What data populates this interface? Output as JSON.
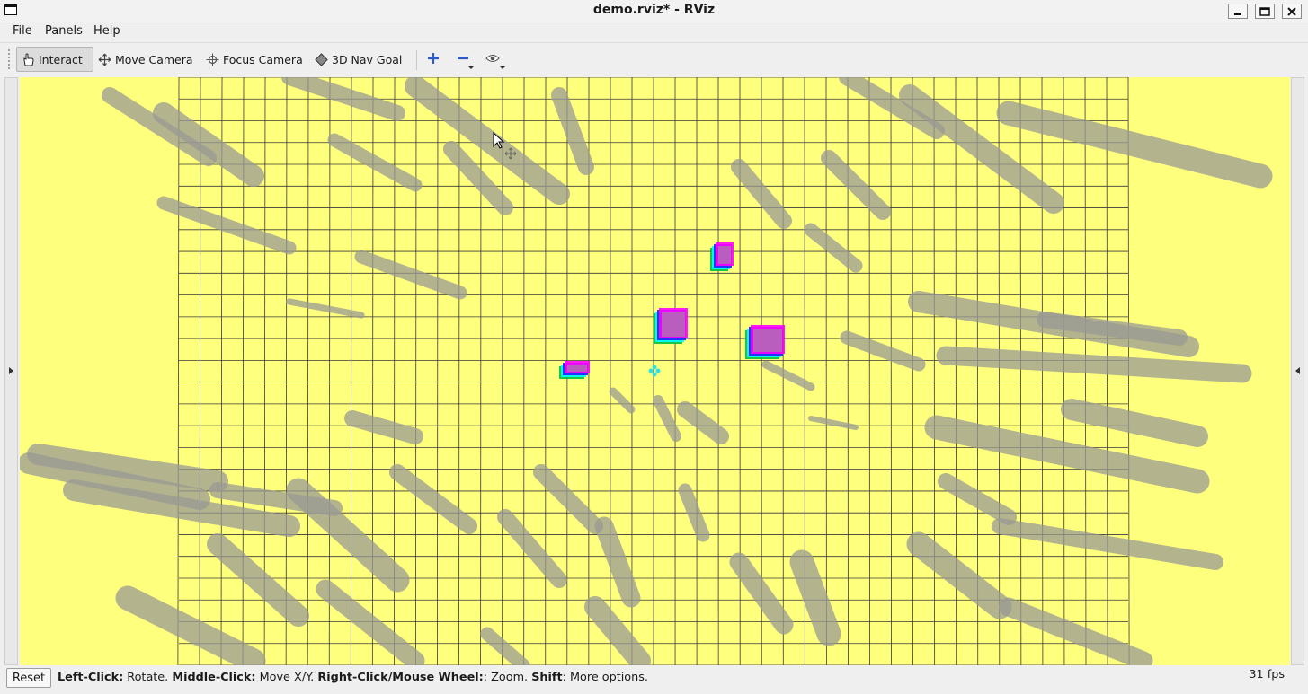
{
  "window": {
    "title": "demo.rviz* - RViz",
    "controls": [
      "minimize-icon",
      "maximize-icon",
      "close-icon"
    ]
  },
  "menu": [
    {
      "label": "File"
    },
    {
      "label": "Panels"
    },
    {
      "label": "Help"
    }
  ],
  "toolbar": {
    "tools": [
      {
        "label": "Interact",
        "icon": "hand-pointer-icon",
        "active": true
      },
      {
        "label": "Move Camera",
        "icon": "move-arrows-icon"
      },
      {
        "label": "Focus Camera",
        "icon": "crosshair-icon"
      },
      {
        "label": "3D Nav Goal",
        "icon": "diamond-icon"
      }
    ],
    "icon_buttons": [
      "add-tool-icon",
      "remove-tool-icon",
      "eye-icon"
    ]
  },
  "viewport": {
    "background_color": "#ffff7e",
    "grid_color": "#3a3a3a",
    "obstacle_color": "#9a9a94",
    "marker_colors": [
      "#ff00ff",
      "#00ffff",
      "#2020ff",
      "#00c040"
    ]
  },
  "status": {
    "reset_label": "Reset",
    "hint": {
      "left_click_key": "Left-Click:",
      "left_click_desc": " Rotate. ",
      "middle_click_key": "Middle-Click:",
      "middle_click_desc": " Move X/Y. ",
      "right_click_key": "Right-Click/Mouse Wheel:",
      "right_click_desc": ": Zoom. ",
      "shift_key": "Shift",
      "shift_desc": ": More options."
    },
    "fps": "31 fps"
  }
}
